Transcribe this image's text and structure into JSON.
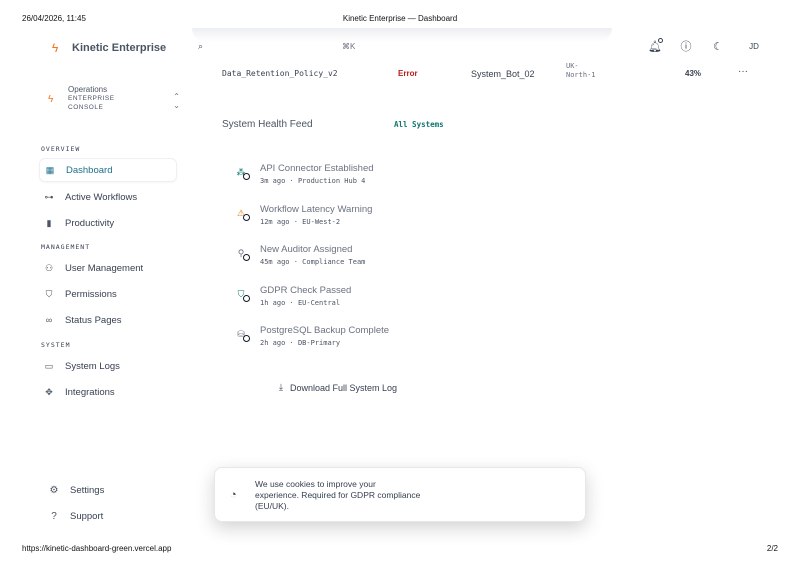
{
  "print": {
    "date": "26/04/2026, 11:45",
    "title": "Kinetic Enterprise — Dashboard",
    "url": "https://kinetic-dashboard-green.vercel.app",
    "page": "2/2"
  },
  "brand": {
    "name": "Kinetic Enterprise",
    "icon": "bolt-icon"
  },
  "org": {
    "name": "Operations",
    "line1": "ENTERPRISE",
    "line2": "CONSOLE"
  },
  "topbar": {
    "shortcut": "⌘K",
    "avatar": "JD"
  },
  "sidebar": {
    "sections": {
      "overview": "OVERVIEW",
      "management": "MANAGEMENT",
      "system": "SYSTEM"
    },
    "items": [
      {
        "label": "Dashboard",
        "icon": "grid-icon",
        "active": true
      },
      {
        "label": "Active Workflows",
        "icon": "workflow-icon"
      },
      {
        "label": "Productivity",
        "icon": "bar-chart-icon"
      },
      {
        "label": "User Management",
        "icon": "users-icon"
      },
      {
        "label": "Permissions",
        "icon": "shield-icon"
      },
      {
        "label": "Status Pages",
        "icon": "link-icon"
      },
      {
        "label": "System Logs",
        "icon": "terminal-icon"
      },
      {
        "label": "Integrations",
        "icon": "integrations-icon"
      }
    ],
    "bottom": [
      {
        "label": "Settings",
        "icon": "gear-icon"
      },
      {
        "label": "Support",
        "icon": "help-icon"
      }
    ]
  },
  "table_row": {
    "policy": "Data_Retention_Policy_v2",
    "status": "Error",
    "owner": "System_Bot_02",
    "region_line1": "UK-",
    "region_line2": "North-1",
    "percent": "43%",
    "more": "···",
    "status_color": "#b91c1c"
  },
  "feed": {
    "title": "System Health Feed",
    "filter": "All Systems",
    "events": [
      {
        "title": "API Connector Established",
        "time": "3m ago",
        "source": "Production Hub 4",
        "icon": "network-icon"
      },
      {
        "title": "Workflow Latency Warning",
        "time": "12m ago",
        "source": "EU-West-2",
        "icon": "warning-icon"
      },
      {
        "title": "New Auditor Assigned",
        "time": "45m ago",
        "source": "Compliance Team",
        "icon": "user-add-icon"
      },
      {
        "title": "GDPR Check Passed",
        "time": "1h ago",
        "source": "EU-Central",
        "icon": "shield-check-icon"
      },
      {
        "title": "PostgreSQL Backup Complete",
        "time": "2h ago",
        "source": "DB-Primary",
        "icon": "database-icon"
      }
    ],
    "download_label": "Download Full System Log"
  },
  "cookie": {
    "line1": "We use cookies to improve your",
    "line2": "experience. Required for GDPR compliance",
    "line3": "(EU/UK)."
  }
}
